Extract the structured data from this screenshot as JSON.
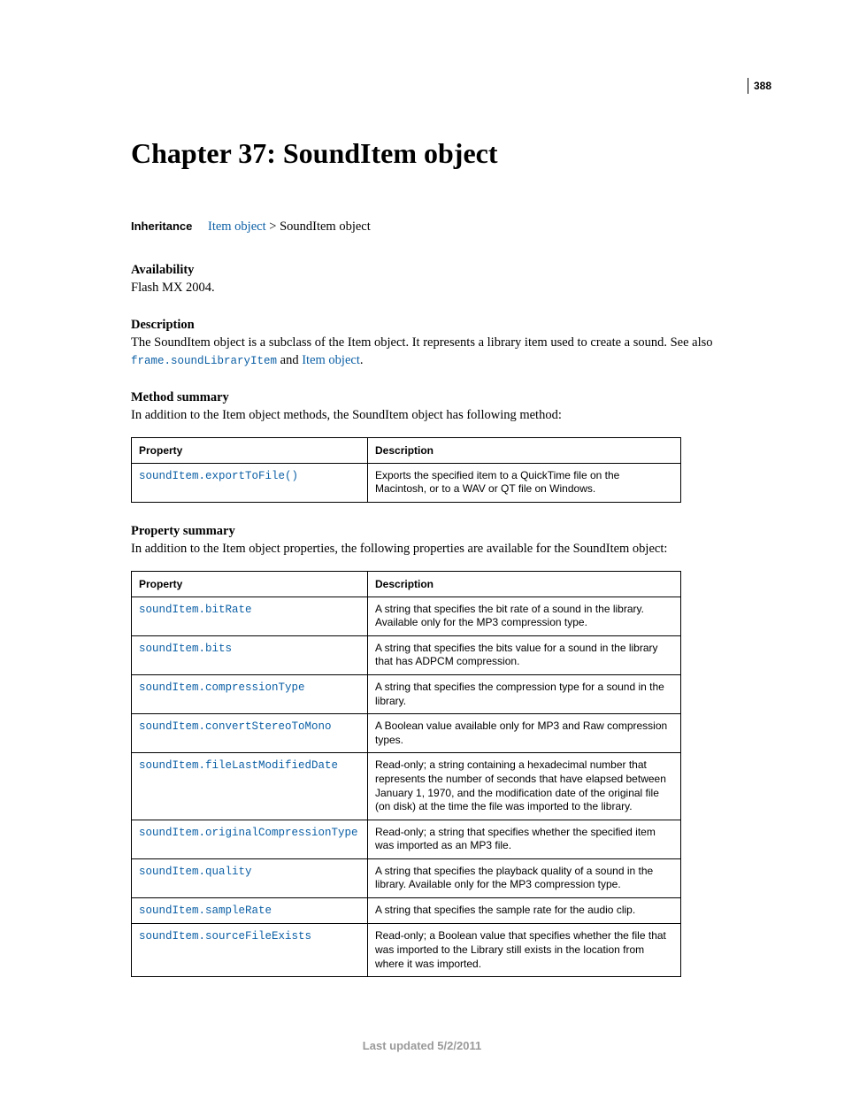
{
  "page_number": "388",
  "chapter_title": "Chapter 37: SoundItem object",
  "inheritance": {
    "label": "Inheritance",
    "link": "Item object",
    "sep": " > ",
    "current": "SoundItem object"
  },
  "availability": {
    "heading": "Availability",
    "text": "Flash MX 2004."
  },
  "description": {
    "heading": "Description",
    "prefix": "The SoundItem object is a subclass of the Item object. It represents a library item used to create a sound. See also ",
    "code_link": "frame.soundLibraryItem",
    "and": " and ",
    "link2": "Item object",
    "suffix": "."
  },
  "method_summary": {
    "heading": "Method summary",
    "intro": "In addition to the Item object methods, the SoundItem object has following method:",
    "col1": "Property",
    "col2": "Description",
    "rows": [
      {
        "prop": "soundItem.exportToFile()",
        "desc": "Exports the specified item to a QuickTime file on the Macintosh, or to a WAV or QT file on Windows."
      }
    ]
  },
  "property_summary": {
    "heading": "Property summary",
    "intro": "In addition to the Item object properties, the following properties are available for the SoundItem object:",
    "col1": "Property",
    "col2": "Description",
    "rows": [
      {
        "prop": "soundItem.bitRate",
        "desc": "A string that specifies the bit rate of a sound in the library. Available only for the MP3 compression type."
      },
      {
        "prop": "soundItem.bits",
        "desc": "A string that specifies the bits value for a sound in the library that has ADPCM compression."
      },
      {
        "prop": "soundItem.compressionType",
        "desc": "A string that specifies the compression type for a sound in the library."
      },
      {
        "prop": "soundItem.convertStereoToMono",
        "desc": "A Boolean value available only for MP3 and Raw compression types."
      },
      {
        "prop": "soundItem.fileLastModifiedDate",
        "desc": "Read-only; a string containing a hexadecimal number that represents the number of seconds that have elapsed between January 1, 1970, and the modification date of the original file (on disk) at the time the file was imported to the library."
      },
      {
        "prop": "soundItem.originalCompressionType",
        "desc": "Read-only; a string that specifies whether the specified item was imported as an MP3 file."
      },
      {
        "prop": "soundItem.quality",
        "desc": "A string that specifies the playback quality of a sound in the library. Available only for the MP3 compression type."
      },
      {
        "prop": "soundItem.sampleRate",
        "desc": "A string that specifies the sample rate for the audio clip."
      },
      {
        "prop": "soundItem.sourceFileExists",
        "desc": "Read-only; a Boolean value that specifies whether the file that was imported to the Library still exists in the location from where it was imported."
      }
    ]
  },
  "footer": "Last updated 5/2/2011"
}
